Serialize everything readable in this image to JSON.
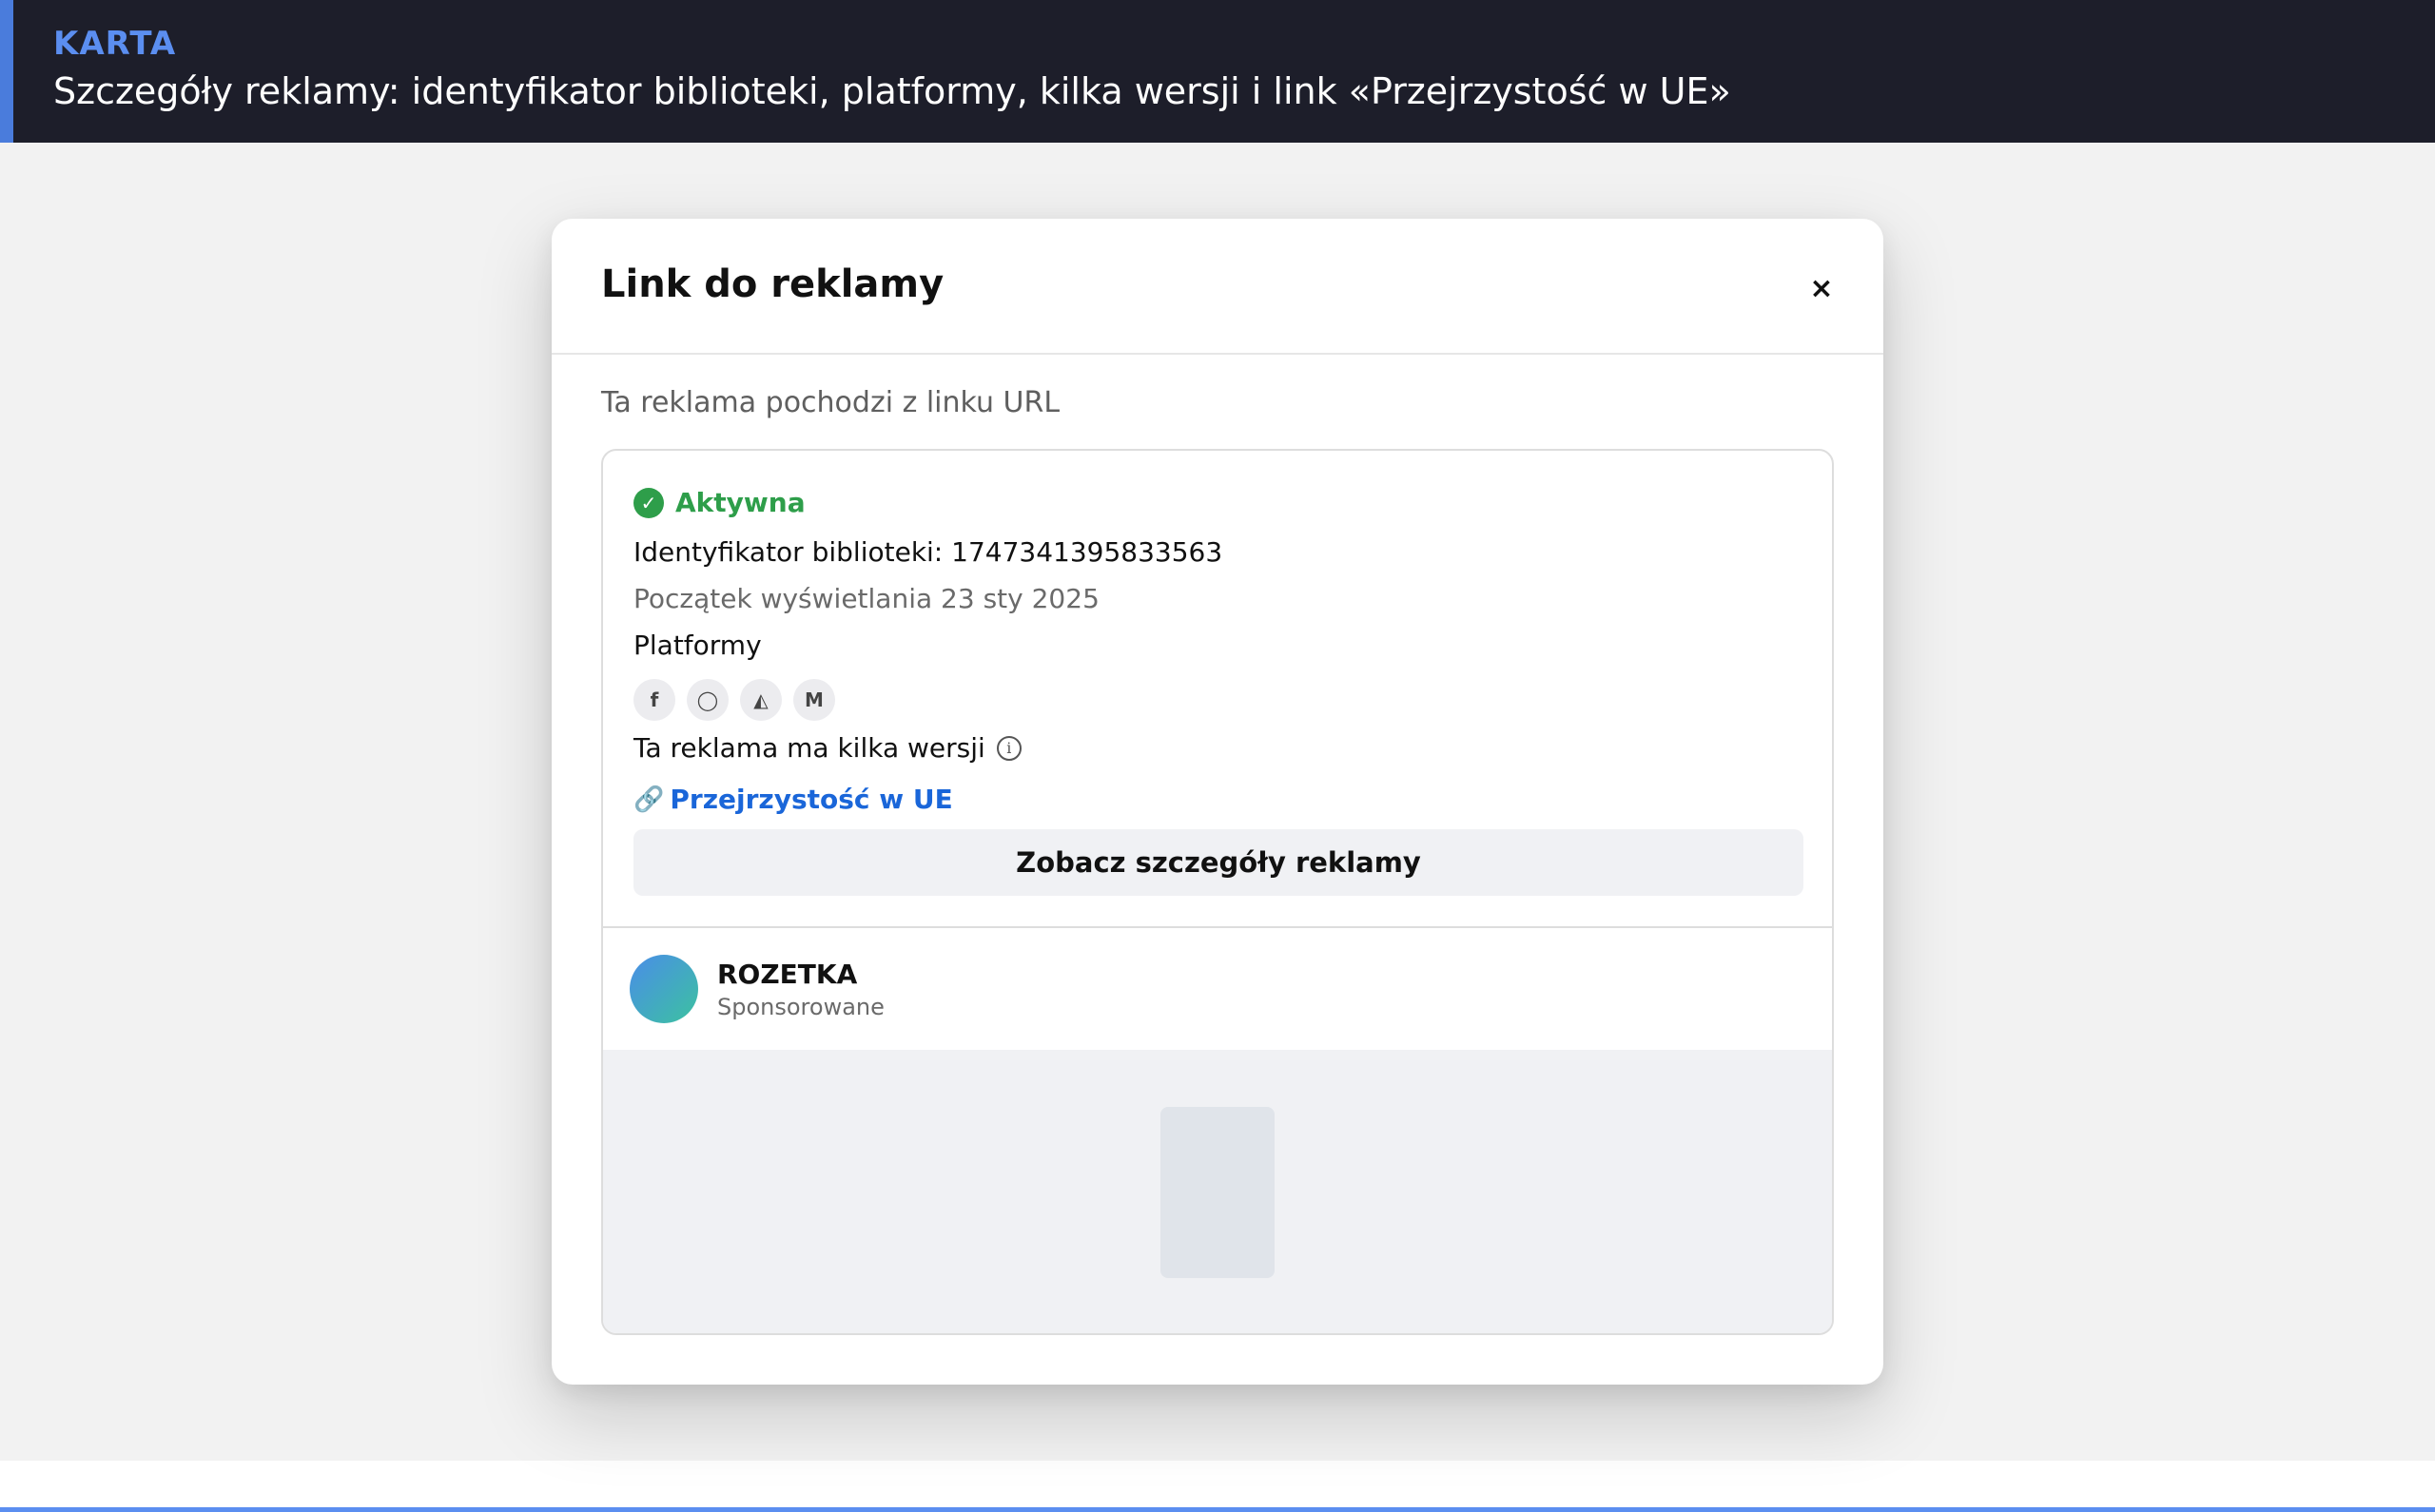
{
  "banner": {
    "kicker": "KARTA",
    "heading": "Szczegóły reklamy: identyfikator biblioteki, platformy, kilka wersji i link «Przejrzystość w UE»"
  },
  "modal": {
    "title": "Link do reklamy",
    "close_label": "×",
    "intro": "Ta reklama pochodzi z linku URL"
  },
  "ad": {
    "status_icon": "✓",
    "status": "Aktywna",
    "library_id": "Identyfikator biblioteki: 1747341395833563",
    "start": "Początek wyświetlania 23 sty 2025",
    "platforms_label": "Platformy",
    "platforms": [
      {
        "name": "facebook-icon",
        "glyph": "f"
      },
      {
        "name": "instagram-icon",
        "glyph": "◯"
      },
      {
        "name": "audience-network-icon",
        "glyph": "◭"
      },
      {
        "name": "messenger-icon",
        "glyph": "M"
      }
    ],
    "versions_text": "Ta reklama ma kilka wersji",
    "info_glyph": "i",
    "link_glyph": "🔗",
    "eu_link": "Przejrzystość w UE",
    "details_button": "Zobacz szczegóły reklamy"
  },
  "advertiser": {
    "name": "ROZETKA",
    "sponsored": "Sponsorowane"
  },
  "colors": {
    "accent": "#5b8ef0",
    "active": "#2e9e4a",
    "link": "#1a66d9",
    "banner_bg": "#1d1e2a"
  }
}
